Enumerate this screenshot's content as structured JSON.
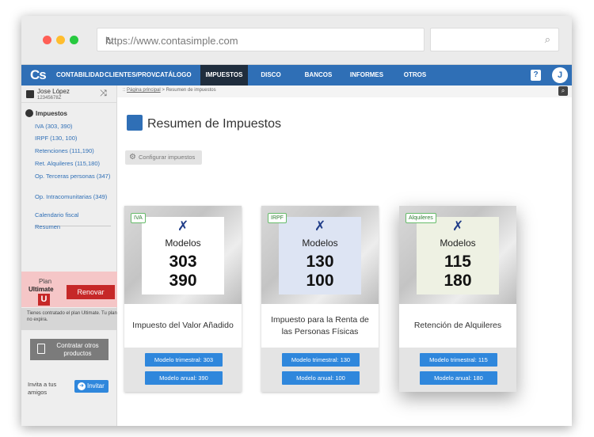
{
  "browser": {
    "url": "https://www.contasimple.com",
    "dots": [
      "#ff5f56",
      "#ffbd2e",
      "#27c93f"
    ]
  },
  "nav": {
    "logo": "Cs",
    "items": [
      {
        "label": "CONTABILIDAD",
        "active": false
      },
      {
        "label": "CLIENTES/PROV.",
        "active": false
      },
      {
        "label": "CATÁLOGO",
        "active": false
      },
      {
        "label": "IMPUESTOS",
        "active": true
      },
      {
        "label": "DISCO VIRTUAL",
        "active": false
      },
      {
        "label": "BANCOS",
        "active": false
      },
      {
        "label": "INFORMES",
        "active": false
      },
      {
        "label": "OTROS",
        "active": false
      }
    ],
    "help_label": "?",
    "user_initial": "J",
    "accent": "#2f6fb6"
  },
  "sidebar": {
    "user_name": "Jose López",
    "user_id": "12345678Z",
    "section_title": "Impuestos",
    "links": [
      "IVA (303, 390)",
      "IRPF (130, 100)",
      "Retenciones (111,190)",
      "Ret. Alquileres (115,180)",
      "Op. Terceras personas (347)",
      "Op. Intracomunitarias (349)",
      "Calendario fiscal",
      "Resumen"
    ],
    "plan_label": "Plan",
    "plan_name": "Ultimate",
    "plan_badge": "U",
    "renew_label": "Renovar",
    "plan_note": "Tienes contratado el plan Ultimate. Tu plan no expira.",
    "buy_label": "Contratar otros productos",
    "invite_text": "Invita a tus amigos",
    "invite_button": "Invitar"
  },
  "breadcrumb": {
    "home": "Página principal",
    "current": "Resumen de impuestos"
  },
  "main": {
    "title": "Resumen de Impuestos",
    "config_button": "Configurar impuestos"
  },
  "cards": [
    {
      "tag": "IVA",
      "models_label": "Modelos",
      "num1": "303",
      "num2": "390",
      "panel_color": "#ffffff",
      "desc": "Impuesto del Valor Añadido",
      "btn1": "Modelo trimestral: 303",
      "btn2": "Modelo anual: 390"
    },
    {
      "tag": "IRPF",
      "models_label": "Modelos",
      "num1": "130",
      "num2": "100",
      "panel_color": "#dde4f3",
      "desc": "Impuesto para la Renta de las Personas Físicas",
      "btn1": "Modelo trimestral: 130",
      "btn2": "Modelo anual: 100"
    },
    {
      "tag": "Alquileres",
      "models_label": "Modelos",
      "num1": "115",
      "num2": "180",
      "panel_color": "#eef1e3",
      "desc": "Retención de Alquileres",
      "btn1": "Modelo trimestral: 115",
      "btn2": "Modelo anual: 180"
    }
  ]
}
